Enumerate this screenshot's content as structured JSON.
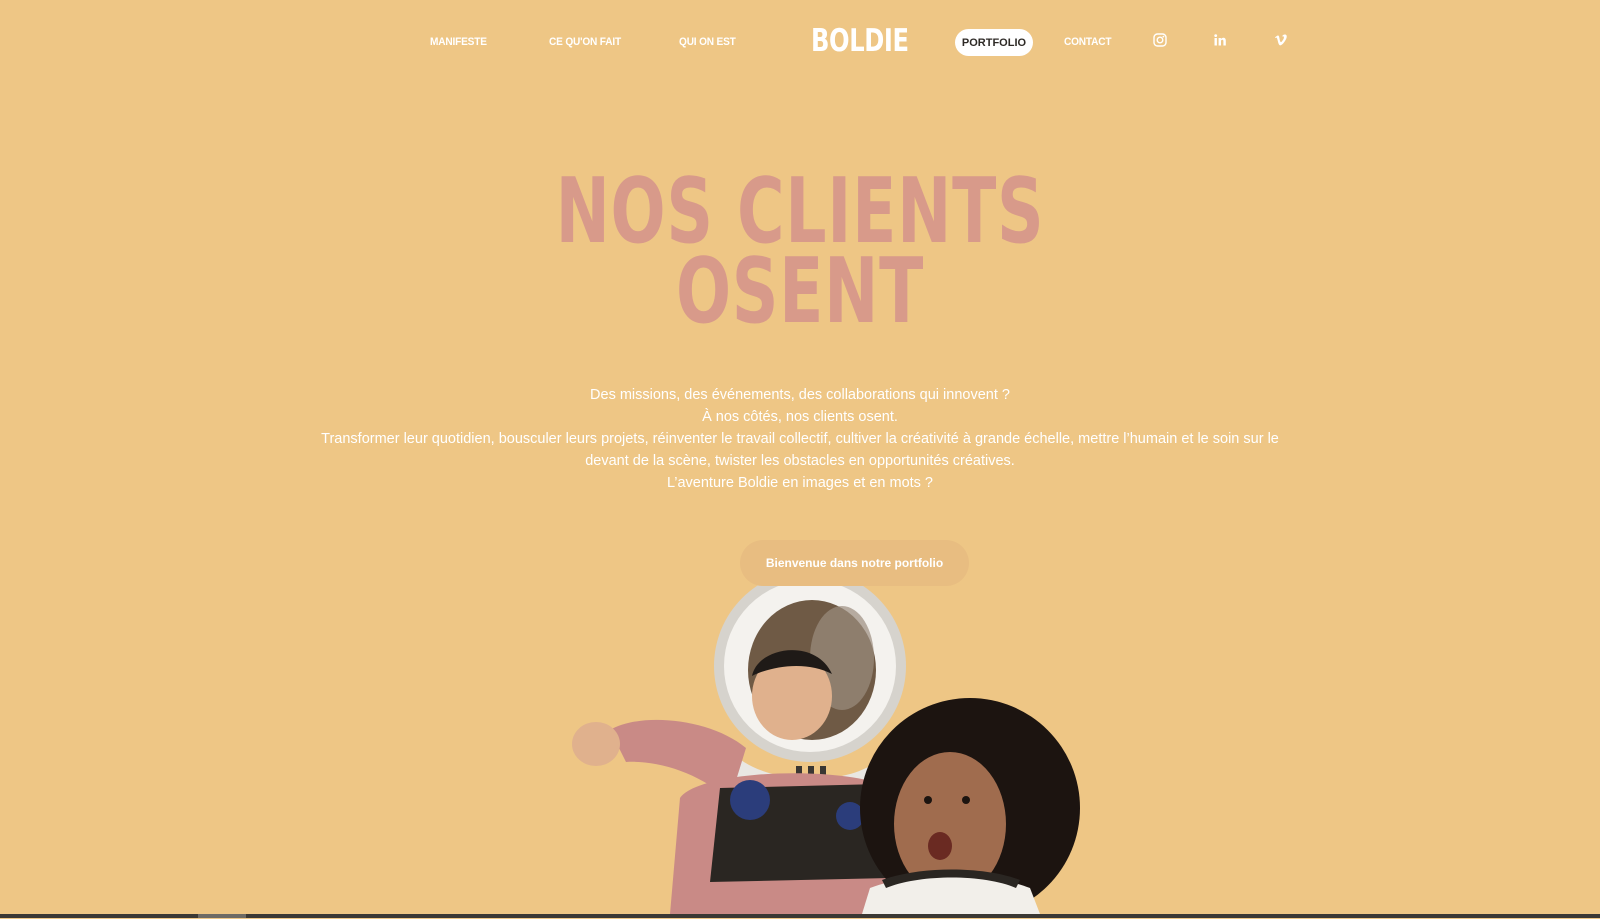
{
  "nav": {
    "links": [
      {
        "label": "MANIFESTE"
      },
      {
        "label": "CE QU'ON FAIT"
      },
      {
        "label": "QUI ON EST"
      }
    ],
    "logo": "BOLDIE",
    "active": "PORTFOLIO",
    "contact": "CONTACT",
    "social": [
      "instagram-icon",
      "linkedin-icon",
      "vimeo-icon"
    ]
  },
  "hero": {
    "title_line1": "NOS CLIENTS",
    "title_line2": "OSENT",
    "paragraphs": [
      "Des missions, des événements, des collaborations qui innovent ?",
      "À nos côtés, nos clients osent.",
      "Transformer leur quotidien, bousculer leurs projets, réinventer le travail collectif, cultiver la créativité à grande échelle, mettre l’humain et le soin sur le devant de la scène, twister les obstacles en opportunités créatives.",
      "L’aventure Boldie en images et en mots ?"
    ],
    "cta": "Bienvenue dans notre portfolio"
  },
  "colors": {
    "background": "#eec685",
    "title": "#d89a8a",
    "text": "#ffffff"
  }
}
